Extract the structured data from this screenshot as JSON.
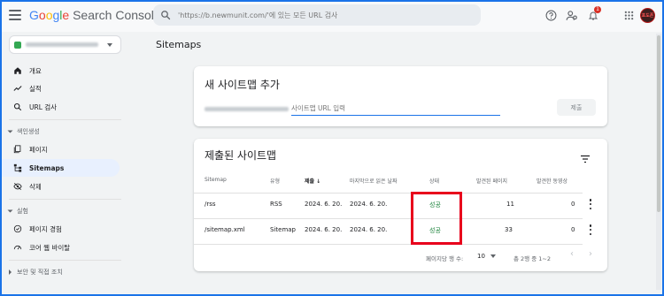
{
  "header": {
    "logo_google": "Google",
    "logo_product": "Search Console",
    "search_placeholder": "'https://b.newmunit.com/'에 있는 모든 URL 검사",
    "notification_count": "1",
    "avatar_text": "포도폰"
  },
  "sidebar": {
    "items": [
      {
        "label": "개요",
        "icon": "home-icon"
      },
      {
        "label": "실적",
        "icon": "trending-up-icon"
      },
      {
        "label": "URL 검사",
        "icon": "search-icon"
      }
    ],
    "index_section": "색인생성",
    "index_items": [
      {
        "label": "페이지",
        "icon": "pages-icon"
      },
      {
        "label": "Sitemaps",
        "icon": "sitemap-icon"
      },
      {
        "label": "삭제",
        "icon": "visibility-off-icon"
      }
    ],
    "experience_section": "실험",
    "experience_items": [
      {
        "label": "페이지 경험",
        "icon": "page-experience-icon"
      },
      {
        "label": "코어 웹 바이탈",
        "icon": "speed-icon"
      }
    ],
    "security_section": "보안 및 직접 조치"
  },
  "main": {
    "page_title": "Sitemaps",
    "add_card": {
      "title": "새 사이트맵 추가",
      "input_placeholder": "사이트맵 URL 입력",
      "submit_label": "제출"
    },
    "submitted_card": {
      "title": "제출된 사이트맵",
      "columns": [
        "Sitemap",
        "유형",
        "제출",
        "마지막으로 읽은 날짜",
        "상태",
        "발견된 페이지",
        "발견한 동영상"
      ],
      "rows": [
        {
          "sitemap": "/rss",
          "type": "RSS",
          "submitted": "2024. 6. 20.",
          "last_read": "2024. 6. 20.",
          "status": "성공",
          "pages": "11",
          "videos": "0"
        },
        {
          "sitemap": "/sitemap.xml",
          "type": "Sitemap",
          "submitted": "2024. 6. 20.",
          "last_read": "2024. 6. 20.",
          "status": "성공",
          "pages": "33",
          "videos": "0"
        }
      ],
      "rows_per_page_label": "페이지당 행 수:",
      "rows_per_page_value": "10",
      "range_label": "총 2행 중 1~2"
    }
  },
  "colors": {
    "accent": "#1a73e8",
    "success": "#188038",
    "highlight": "#e8001c",
    "active_nav": "#e8f0fe"
  }
}
